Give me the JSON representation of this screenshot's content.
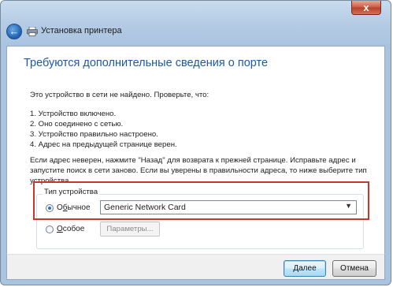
{
  "window": {
    "close_label": "x",
    "title": "Установка принтера"
  },
  "page": {
    "heading": "Требуются дополнительные сведения о порте",
    "intro": "Это устройство в сети не найдено. Проверьте, что:",
    "checklist": [
      "1.  Устройство включено.",
      "2.  Оно соединено с сетью.",
      "3.  Устройство правильно настроено.",
      "4.  Адрес на предыдущей странице верен."
    ],
    "instructions": [
      "Если адрес неверен, нажмите \"Назад\" для возврата к прежней странице.  Исправьте адрес и",
      "запустите поиск в сети заново.  Если вы уверены в правильности адреса, то ниже выберите тип",
      "устройства."
    ]
  },
  "device_type": {
    "legend": "Тип устройства",
    "standard_option": {
      "label_prefix": "О",
      "label_underlined": "б",
      "label_rest": "ычное",
      "selected": true
    },
    "custom_option": {
      "label_underlined": "О",
      "label_rest": "собое",
      "selected": false
    },
    "select_value": "Generic Network Card",
    "params_button": "Параметры..."
  },
  "footer": {
    "next_button": "Далее",
    "next_underlined": "Д",
    "next_rest": "алее",
    "cancel_button": "Отмена"
  },
  "colors": {
    "heading": "#1d5aa0",
    "highlight_border": "#c8372c"
  },
  "icons": {
    "back": "back-arrow-icon",
    "printer": "printer-icon",
    "dropdown": "chevron-down-icon"
  }
}
